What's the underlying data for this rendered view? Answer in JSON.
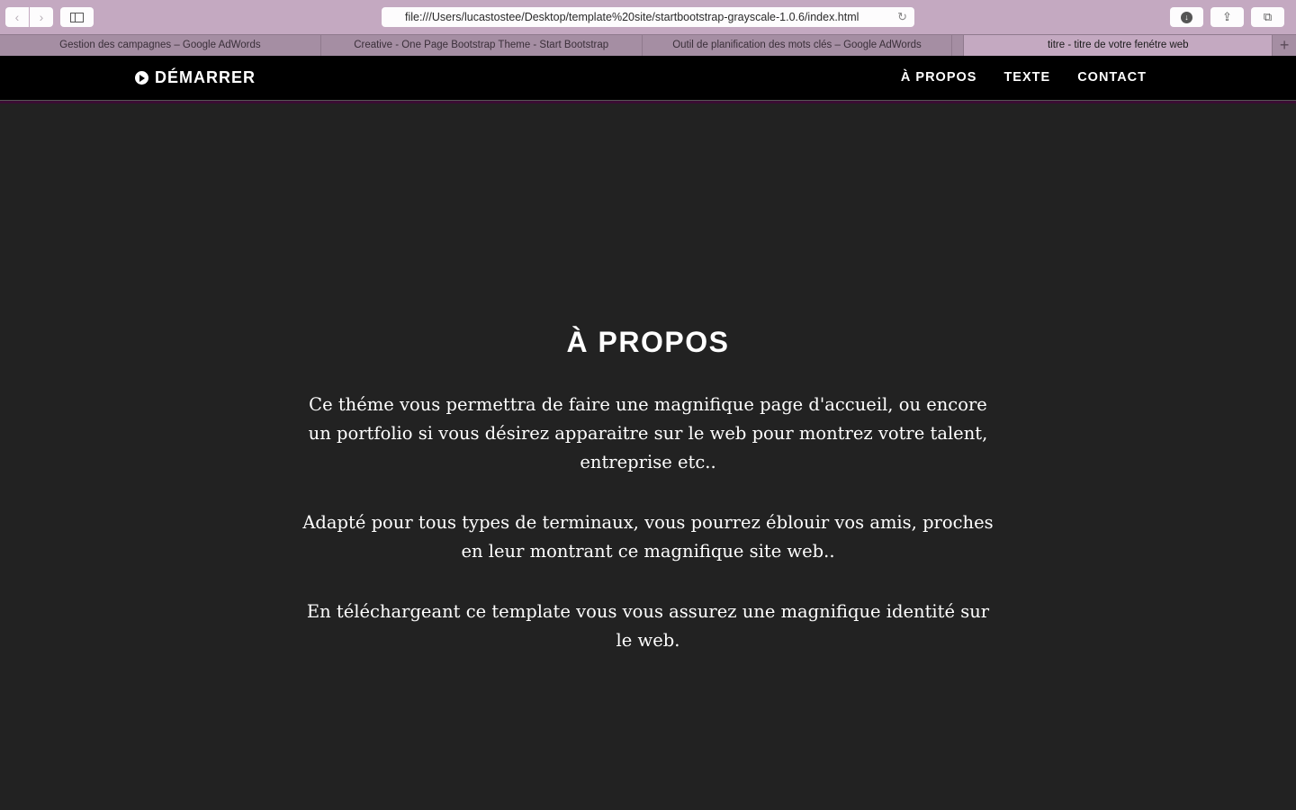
{
  "browser": {
    "url": "file:///Users/lucastostee/Desktop/template%20site/startbootstrap-grayscale-1.0.6/index.html",
    "icons": {
      "back": "chevron-left-icon",
      "forward": "chevron-right-icon",
      "sidebar": "sidebar-icon",
      "reload": "reload-icon",
      "download": "download-icon",
      "share": "share-icon",
      "tabs": "tab-overview-icon",
      "new_tab": "plus-icon"
    },
    "glyphs": {
      "back": "‹",
      "forward": "›",
      "reload": "↻",
      "download": "↓",
      "share": "⇪",
      "tabs": "⧉",
      "new_tab": "+"
    },
    "tabs": [
      {
        "label": "Gestion des campagnes – Google AdWords",
        "active": false
      },
      {
        "label": "Creative - One Page Bootstrap Theme - Start Bootstrap",
        "active": false
      },
      {
        "label": "Outil de planification des mots clés – Google AdWords",
        "active": false
      },
      {
        "label": "titre - titre de votre fenétre web",
        "active": true
      }
    ]
  },
  "site": {
    "brand": "DÉMARRER",
    "nav": [
      "À PROPOS",
      "TEXTE",
      "CONTACT"
    ],
    "section": {
      "title": "À PROPOS",
      "paragraphs": [
        "Ce théme vous permettra de faire une magnifique page d'accueil, ou encore un portfolio si vous désirez apparaitre sur le web pour montrez votre talent, entreprise etc..",
        "Adapté pour tous types de terminaux, vous pourrez éblouir vos amis, proches en leur montrant ce magnifique site web..",
        "En téléchargeant ce template vous vous assurez une magnifique identité sur le web."
      ]
    }
  },
  "colors": {
    "chrome": "#c4a9c1",
    "navbar": "#000000",
    "background": "#222222",
    "accent_line": "#3a0c33",
    "text": "#ffffff"
  }
}
